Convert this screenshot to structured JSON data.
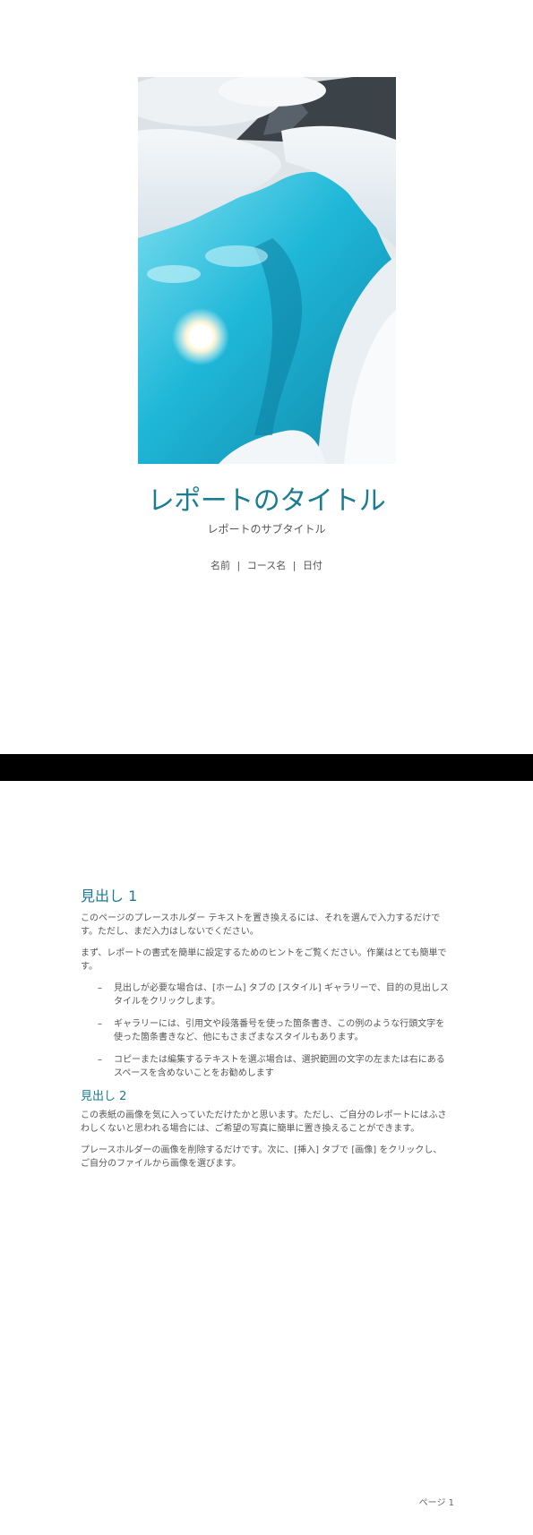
{
  "cover": {
    "title": "レポートのタイトル",
    "subtitle": "レポートのサブタイトル",
    "meta": {
      "name": "名前",
      "course": "コース名",
      "date": "日付",
      "separator": "|"
    }
  },
  "body": {
    "heading1": "見出し 1",
    "para1": "このページのプレースホルダー テキストを置き換えるには、それを選んで入力するだけです。ただし、まだ入力はしないでください。",
    "para2": "まず、レポートの書式を簡単に設定するためのヒントをご覧ください。作業はとても簡単です。",
    "bullets": [
      "見出しが必要な場合は、[ホーム] タブの [スタイル] ギャラリーで、目的の見出しスタイルをクリックします。",
      "ギャラリーには、引用文や段落番号を使った箇条書き、この例のような行頭文字を使った箇条書きなど、他にもさまざまなスタイルもあります。",
      "コピーまたは編集するテキストを選ぶ場合は、選択範囲の文字の左または右にあるスペースを含めないことをお勧めします"
    ],
    "bullet_marker": "–",
    "heading2": "見出し 2",
    "para3": "この表紙の画像を気に入っていただけたかと思います。ただし、ご自分のレポートにはふさわしくないと思われる場合には、ご希望の写真に簡単に置き換えることができます。",
    "para4": "プレースホルダーの画像を削除するだけです。次に、[挿入] タブで [画像] をクリックし、ご自分のファイルから画像を選びます。"
  },
  "footer": {
    "page_number": "ページ 1"
  },
  "colors": {
    "accent": "#1a7c93",
    "text": "#555555",
    "band": "#000000"
  }
}
